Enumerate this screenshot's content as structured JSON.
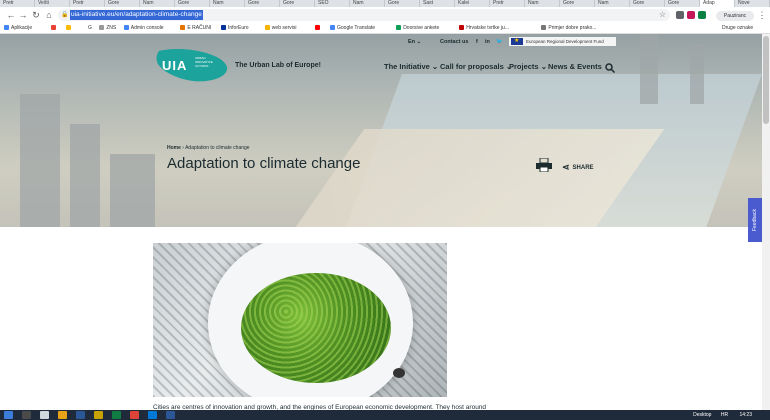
{
  "browser": {
    "tabs": [
      "Pretr",
      "Vešti",
      "Pretr",
      "Gore",
      "Nam",
      "Gore",
      "Nam",
      "Gore",
      "Gore",
      "SEO",
      "Nam",
      "Gore",
      "Sast",
      "Kalei",
      "Pretr",
      "Nam",
      "Gore",
      "Nam",
      "Gore",
      "Gore",
      "Adap",
      "Nove"
    ],
    "url": "uia-initiative.eu/en/adaptation-climate-change",
    "profile_label": "Pauziranc",
    "bookmarks": [
      {
        "label": "Aplikacije",
        "color": "#4285f4"
      },
      {
        "label": "",
        "color": "#ea4335"
      },
      {
        "label": "",
        "color": "#fbbc05"
      },
      {
        "label": "G",
        "color": "#ffffff"
      },
      {
        "label": "ZNS",
        "color": "#999999"
      },
      {
        "label": "Admin console",
        "color": "#4285f4"
      },
      {
        "label": "E RAČUNI",
        "color": "#e37400"
      },
      {
        "label": "InforEuro",
        "color": "#003399"
      },
      {
        "label": "web servisi",
        "color": "#f4b400"
      },
      {
        "label": "",
        "color": "#ff0000"
      },
      {
        "label": "Google Translate",
        "color": "#4285f4"
      },
      {
        "label": "Doorsive ankete",
        "color": "#0f9d58"
      },
      {
        "label": "Hrvatske tvrtke ju...",
        "color": "#c00000"
      },
      {
        "label": "Primjer dobre prako...",
        "color": "#777777"
      }
    ],
    "other_bookmarks": "Druge oznake"
  },
  "site": {
    "logo": "UIA",
    "logo_sub": "URBAN INNOVATIVE ACTIONS",
    "tagline": "The Urban Lab of Europe!",
    "language": "En",
    "contact": "Contact us",
    "social": [
      "f",
      "in",
      "🐦"
    ],
    "erdf": "European Regional Development Fund",
    "menu": [
      "The Initiative",
      "Call for proposals",
      "Projects",
      "News & Events"
    ],
    "breadcrumb_home": "Home",
    "breadcrumb_current": "Adaptation to climate change",
    "page_title": "Adaptation to climate change",
    "share": "SHARE",
    "body_text": "Cities are centres of innovation and growth, and the engines of European economic development. They host around",
    "feedback": "Feedback"
  },
  "taskbar": {
    "time": "14:23",
    "lang": "HR",
    "desktop": "Desktop"
  }
}
